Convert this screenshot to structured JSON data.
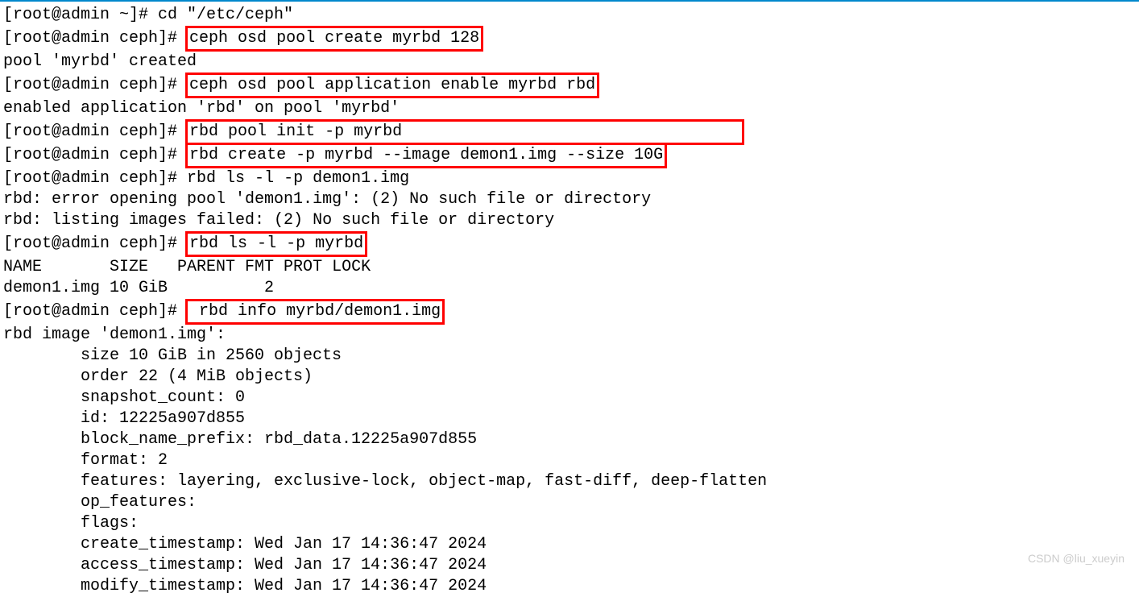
{
  "lines": {
    "l1": {
      "prompt": "[root@admin ~]# ",
      "cmd": "cd \"/etc/ceph\""
    },
    "l2": {
      "prompt": "[root@admin ceph]# ",
      "cmd": "ceph osd pool create myrbd 128"
    },
    "l3": {
      "text": "pool 'myrbd' created"
    },
    "l4": {
      "prompt": "[root@admin ceph]# ",
      "cmd": "ceph osd pool application enable myrbd rbd"
    },
    "l5": {
      "text": "enabled application 'rbd' on pool 'myrbd'"
    },
    "l6": {
      "prompt": "[root@admin ceph]# ",
      "cmd": "rbd pool init -p myrbd"
    },
    "l7": {
      "prompt": "[root@admin ceph]# ",
      "cmd": "rbd create -p myrbd --image demon1.img --size 10G"
    },
    "l8": {
      "prompt": "[root@admin ceph]# ",
      "cmd": "rbd ls -l -p demon1.img"
    },
    "l9": {
      "text": "rbd: error opening pool 'demon1.img': (2) No such file or directory"
    },
    "l10": {
      "text": "rbd: listing images failed: (2) No such file or directory"
    },
    "l11": {
      "prompt": "[root@admin ceph]# ",
      "cmd": "rbd ls -l -p myrbd"
    },
    "l12": {
      "text": "NAME       SIZE   PARENT FMT PROT LOCK"
    },
    "l13": {
      "text": "demon1.img 10 GiB          2"
    },
    "l14": {
      "prompt": "[root@admin ceph]# ",
      "cmd": " rbd info myrbd/demon1.img"
    },
    "l15": {
      "text": "rbd image 'demon1.img':"
    },
    "l16": {
      "text": "size 10 GiB in 2560 objects"
    },
    "l17": {
      "text": "order 22 (4 MiB objects)"
    },
    "l18": {
      "text": "snapshot_count: 0"
    },
    "l19": {
      "text": "id: 12225a907d855"
    },
    "l20": {
      "text": "block_name_prefix: rbd_data.12225a907d855"
    },
    "l21": {
      "text": "format: 2"
    },
    "l22": {
      "text": "features: layering, exclusive-lock, object-map, fast-diff, deep-flatten"
    },
    "l23": {
      "text": "op_features: "
    },
    "l24": {
      "text": "flags: "
    },
    "l25": {
      "text": "create_timestamp: Wed Jan 17 14:36:47 2024"
    },
    "l26": {
      "text": "access_timestamp: Wed Jan 17 14:36:47 2024"
    },
    "l27": {
      "text": "modify_timestamp: Wed Jan 17 14:36:47 2024"
    }
  },
  "watermark": "CSDN @liu_xueyin"
}
